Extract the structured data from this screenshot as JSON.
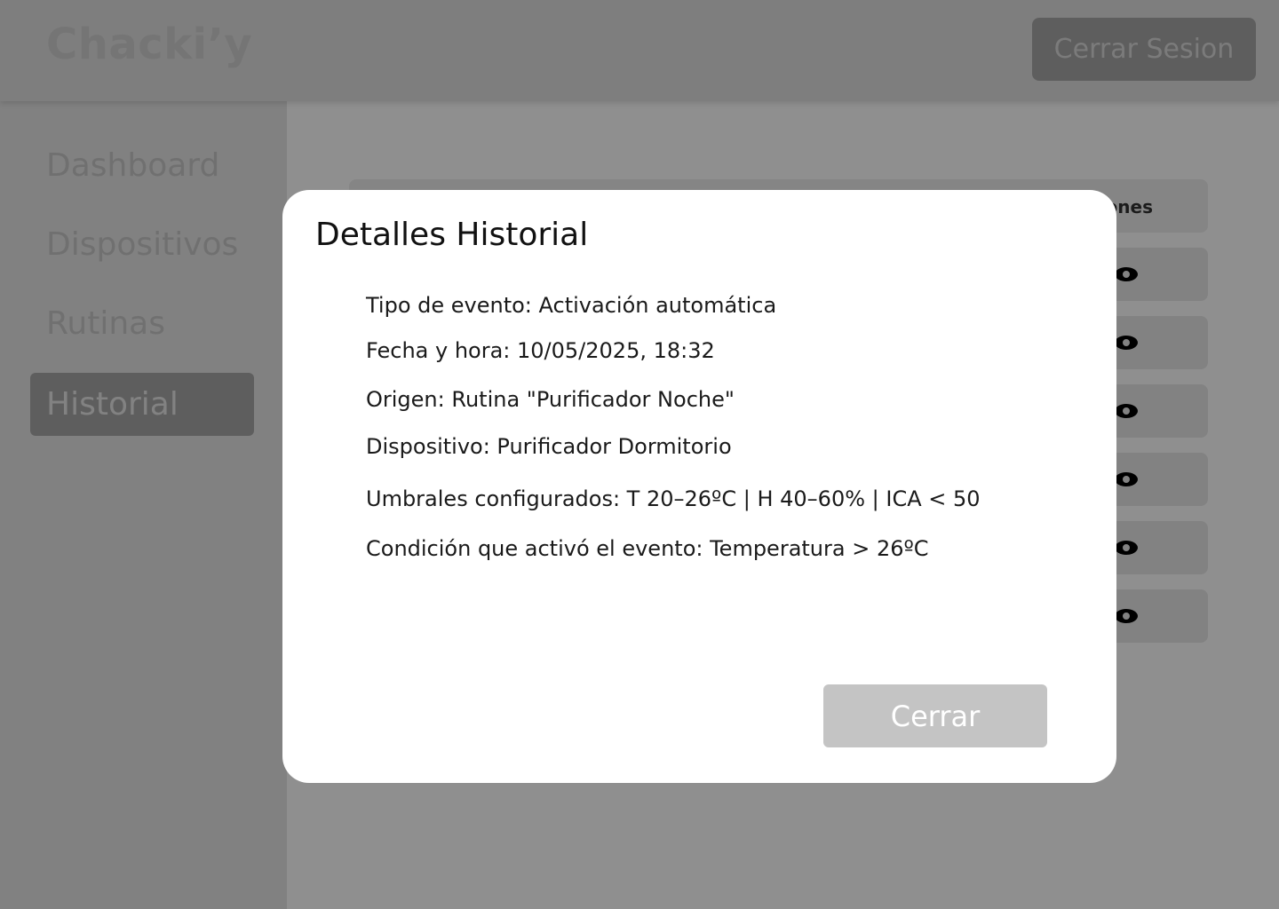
{
  "header": {
    "brand": "Chacki’y",
    "logout_label": "Cerrar Sesion"
  },
  "sidebar": {
    "items": [
      {
        "label": "Dashboard",
        "active": false
      },
      {
        "label": "Dispositivos",
        "active": false
      },
      {
        "label": "Rutinas",
        "active": false
      },
      {
        "label": "Historial",
        "active": true
      }
    ]
  },
  "table": {
    "actions_header": "Acciones",
    "rows": [
      {
        "action_icon": "eye-icon"
      },
      {
        "action_icon": "eye-icon"
      },
      {
        "action_icon": "eye-icon"
      },
      {
        "action_icon": "eye-icon"
      },
      {
        "action_icon": "eye-icon"
      },
      {
        "action_icon": "eye-icon"
      }
    ]
  },
  "modal": {
    "title": "Detalles Historial",
    "details": [
      "Tipo de evento: Activación automática",
      "Fecha y hora: 10/05/2025, 18:32",
      "Origen: Rutina \"Purificador Noche\"",
      "Dispositivo: Purificador Dormitorio",
      "Umbrales configurados: T 20–26ºC | H 40–60% | ICA < 50",
      "Condición que activó el evento: Temperatura > 26ºC"
    ],
    "close_label": "Cerrar"
  }
}
